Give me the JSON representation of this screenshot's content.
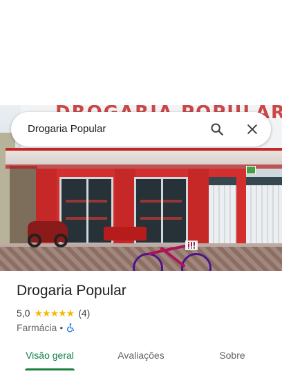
{
  "search": {
    "query": "Drogaria Popular"
  },
  "photo": {
    "sign_text": "DROGARIA POPULAR"
  },
  "place": {
    "name": "Drogaria Popular",
    "rating": "5,0",
    "stars": "★★★★★",
    "review_count": "(4)",
    "category": "Farmácia",
    "separator": "•"
  },
  "tabs": [
    {
      "label": "Visão geral",
      "active": true
    },
    {
      "label": "Avaliações",
      "active": false
    },
    {
      "label": "Sobre",
      "active": false
    }
  ],
  "colors": {
    "accent": "#188038",
    "star": "#f6b900",
    "accessibility": "#1a73e8",
    "facade_red": "#d32f2f"
  },
  "icons": {
    "search": "search-icon",
    "close": "close-icon",
    "accessibility": "wheelchair-icon"
  }
}
